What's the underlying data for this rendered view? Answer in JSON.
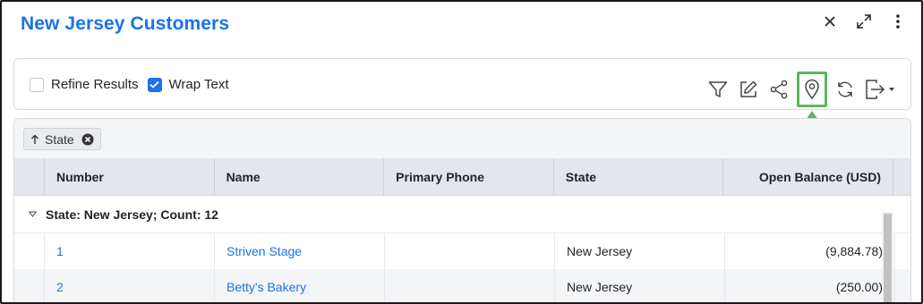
{
  "panel": {
    "title": "New Jersey Customers"
  },
  "window_icons": [
    "close-icon",
    "expand-icon",
    "more-vertical-icon"
  ],
  "toolbar": {
    "refine_results_label": "Refine Results",
    "refine_results_checked": false,
    "wrap_text_label": "Wrap Text",
    "wrap_text_checked": true,
    "tools": [
      "filter-icon",
      "edit-icon",
      "share-icon",
      "map-pin-icon",
      "refresh-icon",
      "export-icon"
    ],
    "highlighted_tool": "map-pin-icon",
    "highlight_color": "#5cb85c"
  },
  "grouping": {
    "chip_label": "State",
    "sort_direction": "ascending"
  },
  "table": {
    "columns": [
      "Number",
      "Name",
      "Primary Phone",
      "State",
      "Open Balance (USD)"
    ],
    "group_label": "State: New Jersey; Count: 12",
    "rows": [
      {
        "number": "1",
        "name": "Striven Stage",
        "phone": "",
        "state": "New Jersey",
        "balance": "(9,884.78)"
      },
      {
        "number": "2",
        "name": "Betty's Bakery",
        "phone": "",
        "state": "New Jersey",
        "balance": "(250.00)"
      }
    ]
  },
  "colors": {
    "accent": "#1a73e8",
    "highlight": "#5cb85c",
    "header_bg": "#e3e6ea"
  }
}
